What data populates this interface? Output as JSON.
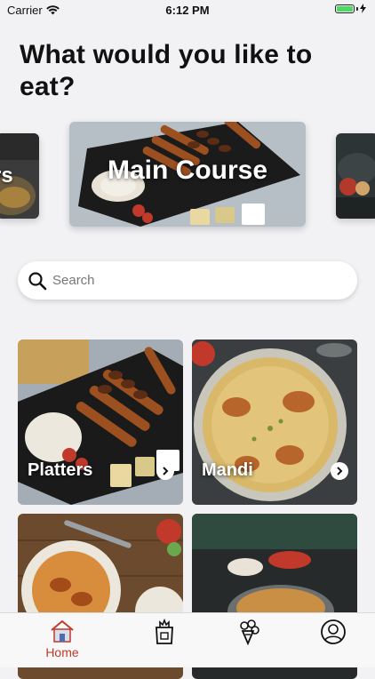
{
  "status_bar": {
    "carrier": "Carrier",
    "time": "6:12 PM"
  },
  "headline": "What would you like to eat?",
  "carousel": {
    "left_label": "rs",
    "main_label": "Main Course"
  },
  "search": {
    "placeholder": "Search",
    "value": ""
  },
  "categories": [
    {
      "label": "Platters"
    },
    {
      "label": "Mandi"
    },
    {
      "label": ""
    },
    {
      "label": ""
    }
  ],
  "tab_bar": {
    "home_label": "Home",
    "accent_color": "#c0392b"
  }
}
